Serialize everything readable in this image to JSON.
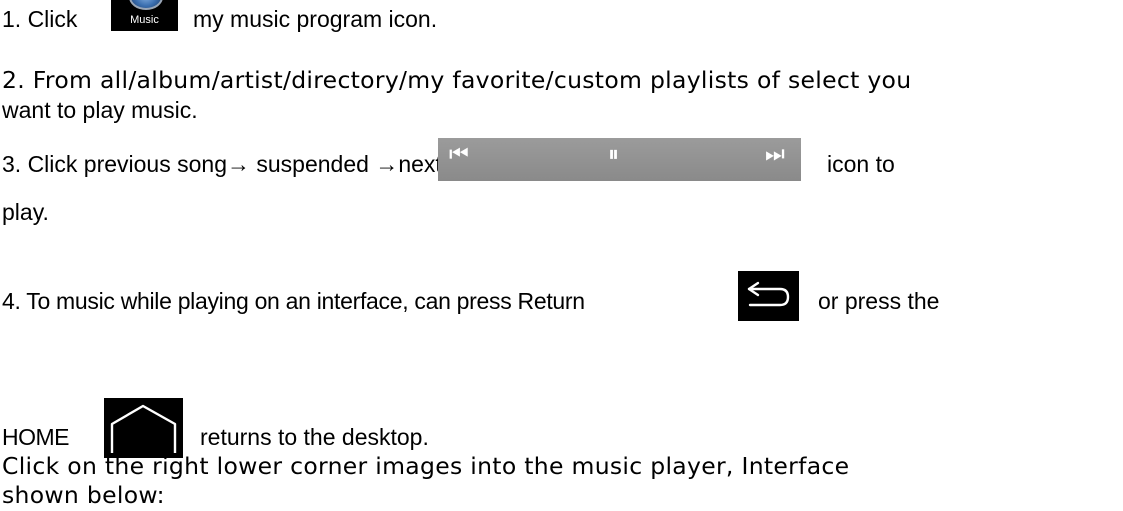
{
  "steps": {
    "s1_prefix": "1. Click",
    "s1_icon_label": "Music",
    "s1_suffix": "my music program icon.",
    "s2_line1": "2. From all/album/artist/directory/my favorite/custom playlists of select you",
    "s2_line2": "want to play music.",
    "s3_prefix": "3. Click previous song",
    "s3_arrow1": "→",
    "s3_mid": " suspended ",
    "s3_arrow2": "→",
    "s3_next": "next song",
    "s3_suffix": "icon to",
    "s3_line2": "play.",
    "s4_line1_prefix": "4. To music while playing on an interface, can press Return",
    "s4_line1_suffix": "or press the",
    "s4_home": "HOME",
    "s4_line2_suffix": "returns to the desktop."
  },
  "closing": {
    "line1": "Click on the right lower corner images into the music player, Interface",
    "line2": "shown below:"
  },
  "icons": {
    "music": "music-app-icon",
    "previous": "skip-previous-icon",
    "pause": "pause-icon",
    "next": "skip-next-icon",
    "return": "return-arrow-icon",
    "home": "home-icon"
  },
  "colors": {
    "transport_bg": "#919191",
    "icon_bg": "#000000",
    "icon_fg": "#ffffff"
  }
}
